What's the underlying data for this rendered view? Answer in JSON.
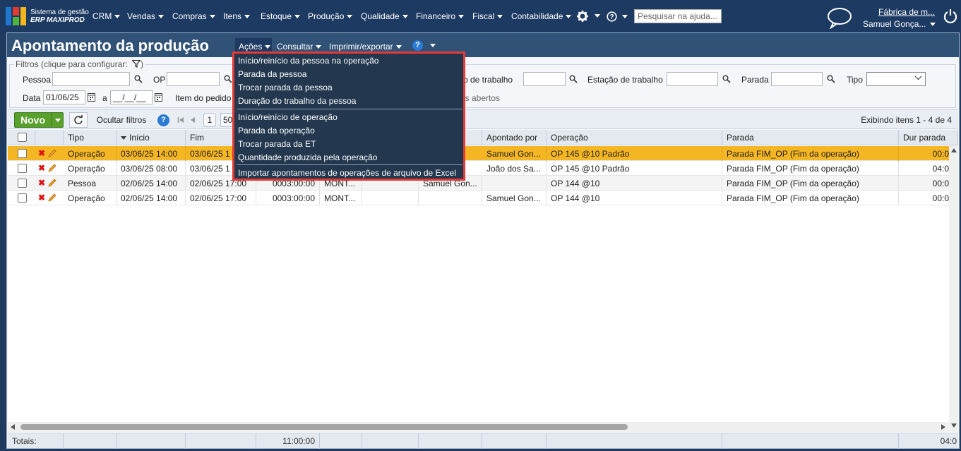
{
  "app": {
    "brand_line1": "Sistema de gestão",
    "brand_line2": "ERP MAXIPROD",
    "search_placeholder": "Pesquisar na ajuda...",
    "company": "Fábrica de m...",
    "user": "Samuel Gonça..."
  },
  "nav": [
    "CRM",
    "Vendas",
    "Compras",
    "Itens",
    "Estoque",
    "Produção",
    "Qualidade",
    "Financeiro",
    "Fiscal",
    "Contabilidade"
  ],
  "page": {
    "title": "Apontamento da produção",
    "menus": [
      "Ações",
      "Consultar",
      "Imprimir/exportar"
    ]
  },
  "filters": {
    "legend": "Filtros (clique para configurar:",
    "legend_end": ")",
    "pessoa_label": "Pessoa",
    "op_label": "OP",
    "centro_label": "ro de trabalho",
    "estacao_label": "Estação de trabalho",
    "parada_label": "Parada",
    "tipo_label": "Tipo",
    "data_label": "Data",
    "data_from": "01/06/25",
    "data_sep": "a",
    "data_to": "__/__/__",
    "item_label": "Item do pedido",
    "abertos_label": "os abertos"
  },
  "toolbar": {
    "novo": "Novo",
    "ocultar": "Ocultar filtros",
    "page": "1",
    "page_size": "50",
    "exibindo": "Exibindo itens 1 - 4 de 4"
  },
  "grid": {
    "headers": [
      "Tipo",
      "Início",
      "Fim",
      "Apontado por",
      "Operação",
      "Parada",
      "Dur parada"
    ],
    "rows": [
      {
        "tipo": "Operação",
        "inicio": "03/06/25 14:00",
        "fim": "03/06/25 1",
        "dur": "",
        "posto": "",
        "c6": "",
        "pessoa": "",
        "apontado": "Samuel Gon...",
        "operacao": "OP 145 @10 Padrão",
        "parada": "Parada FIM_OP (Fim da operação)",
        "durparada": "00:0"
      },
      {
        "tipo": "Operação",
        "inicio": "03/06/25 08:00",
        "fim": "03/06/25 1",
        "dur": "",
        "posto": "",
        "c6": "",
        "pessoa": "",
        "apontado": "João dos Sa...",
        "operacao": "OP 145 @10 Padrão",
        "parada": "Parada FIM_OP (Fim da operação)",
        "durparada": "04:0"
      },
      {
        "tipo": "Pessoa",
        "inicio": "02/06/25 14:00",
        "fim": "02/06/25 17:00",
        "dur": "0003:00:00",
        "posto": "MONT...",
        "c6": "",
        "pessoa": "Samuel Gon...",
        "apontado": "",
        "operacao": "OP 144 @10",
        "parada": "Parada FIM_OP (Fim da operação)",
        "durparada": "00:0"
      },
      {
        "tipo": "Operação",
        "inicio": "02/06/25 14:00",
        "fim": "02/06/25 17:00",
        "dur": "0003:00:00",
        "posto": "MONT...",
        "c6": "",
        "pessoa": "",
        "apontado": "Samuel Gon...",
        "operacao": "OP 144 @10",
        "parada": "Parada FIM_OP (Fim da operação)",
        "durparada": "00:0"
      }
    ]
  },
  "totals": {
    "label": "Totais:",
    "duracao": "11:00:00",
    "durparada": "04:0"
  },
  "dropdown": {
    "group1": [
      "Início/reinício da pessoa na operação",
      "Parada da pessoa",
      "Trocar parada da pessoa",
      "Duração do trabalho da pessoa"
    ],
    "group2": [
      "Início/reinício de operação",
      "Parada da operação",
      "Trocar parada da ET",
      "Quantidade produzida pela operação"
    ],
    "group3": [
      "Importar apontamentos de operações de arquivo de Excel"
    ]
  },
  "colors": {
    "selected_row": "#f5b623",
    "topbar": "#1d3a63",
    "highlight_border": "#e53935",
    "novo_button": "#5aa02c"
  }
}
